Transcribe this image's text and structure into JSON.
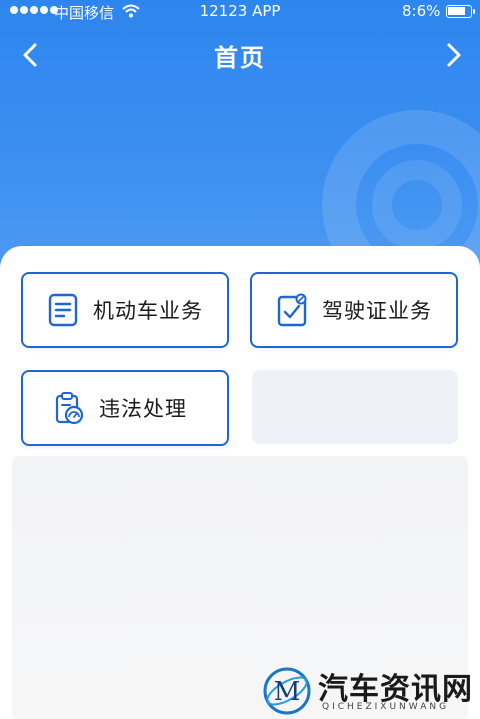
{
  "status_bar": {
    "carrier": "中国移信",
    "app_name": "12123 APP",
    "battery_percent": "8:6%",
    "battery_level": 0.86
  },
  "nav": {
    "title": "首页"
  },
  "tiles": [
    {
      "label": "机动车业务",
      "icon": "document-list-icon"
    },
    {
      "label": "驾驶证业务",
      "icon": "license-check-icon"
    },
    {
      "label": "违法处理",
      "icon": "clipboard-gauge-icon"
    }
  ],
  "watermark": {
    "title": "汽车资讯网",
    "subtitle": "QICHEZIXUNWANG",
    "logo_letter": "M"
  },
  "colors": {
    "header_blue": "#2d86ee",
    "tile_border": "#1f66d1"
  }
}
